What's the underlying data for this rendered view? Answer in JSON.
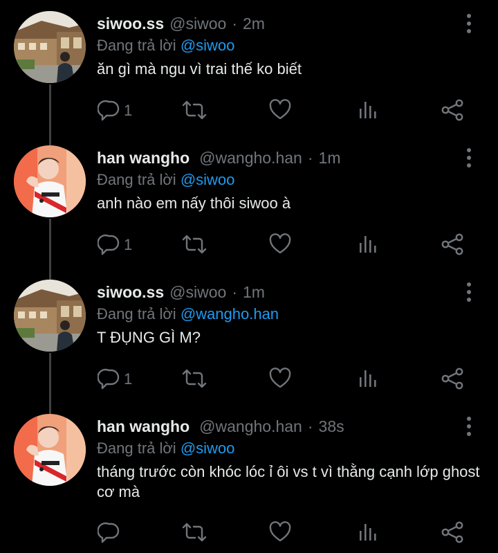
{
  "colors": {
    "background": "#000000",
    "text": "#e7e9ea",
    "muted": "#71767b",
    "accent": "#1d9bf0",
    "thread_line": "#3e4144"
  },
  "tweets": [
    {
      "name": "siwoo.ss",
      "handle": "@siwoo",
      "dot": "·",
      "time": "2m",
      "reply_prefix": "Đang trả lời",
      "reply_to": "@siwoo",
      "text": "ăn gì mà ngu vì trai thế ko biết",
      "reply_count": "1",
      "avatar": "street-photo-avatar"
    },
    {
      "name": "han wangho",
      "handle": "@wangho.han",
      "dot": "·",
      "time": "1m",
      "reply_prefix": "Đang trả lời",
      "reply_to": "@siwoo",
      "text": "anh nào em nấy thôi siwoo à",
      "reply_count": "1",
      "avatar": "jersey-photo-avatar"
    },
    {
      "name": "siwoo.ss",
      "handle": "@siwoo",
      "dot": "·",
      "time": "1m",
      "reply_prefix": "Đang trả lời",
      "reply_to": "@wangho.han",
      "text": "T ĐỤNG GÌ M?",
      "reply_count": "1",
      "avatar": "street-photo-avatar"
    },
    {
      "name": "han wangho",
      "handle": "@wangho.han",
      "dot": "·",
      "time": "38s",
      "reply_prefix": "Đang trả lời",
      "reply_to": "@siwoo",
      "text": "tháng trước còn khóc lóc ỉ ôi vs t vì thằng cạnh lớp ghost cơ mà",
      "reply_count": "",
      "avatar": "jersey-photo-avatar"
    }
  ]
}
